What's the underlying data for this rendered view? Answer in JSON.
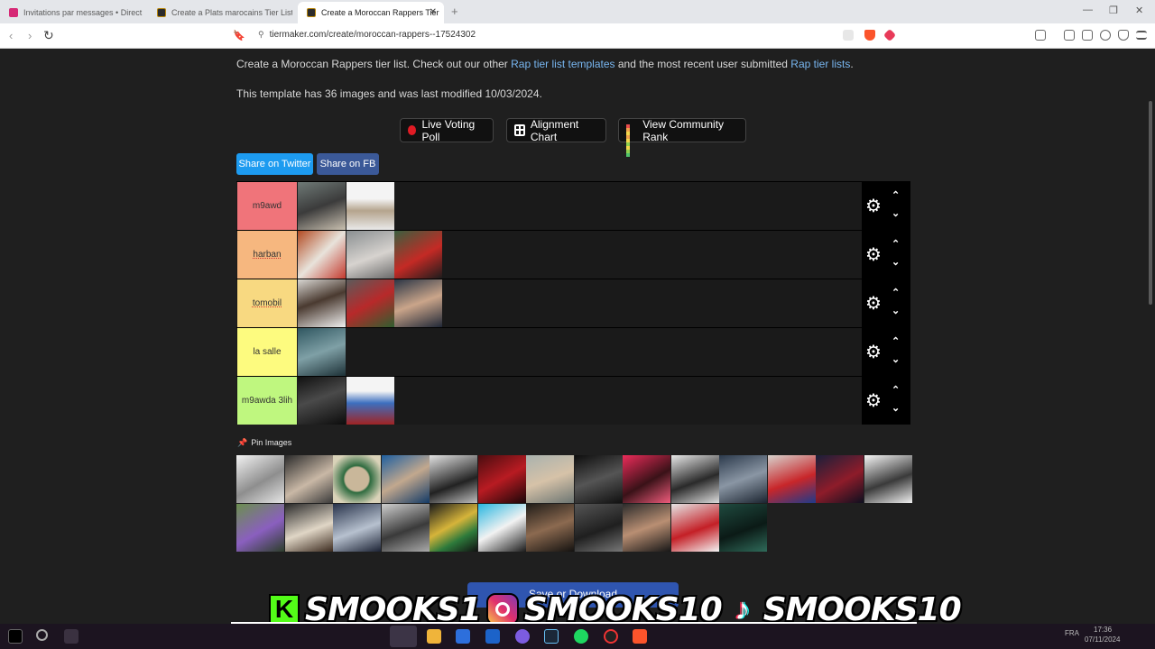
{
  "browser": {
    "tabs": [
      {
        "title": "Invitations par messages • Direct",
        "active": false,
        "favicon_color": "#d62976"
      },
      {
        "title": "Create a Plats marocains Tier List - Ti",
        "active": false,
        "favicon_color": "#2b2b2b"
      },
      {
        "title": "Create a Moroccan Rappers Tier",
        "active": true,
        "favicon_color": "#2b2b2b"
      }
    ],
    "close_glyph": "✕",
    "new_tab_glyph": "+",
    "window_controls": {
      "minimize": "—",
      "maximize": "❐",
      "close": "✕"
    },
    "nav": {
      "back": "‹",
      "forward": "›",
      "reload": "↻",
      "bookmark": "🔖"
    },
    "url": "tiermaker.com/create/moroccan-rappers--17524302",
    "lock_glyph": "⚲"
  },
  "page": {
    "intro": {
      "prefix": "Create a Moroccan Rappers tier list. Check out our other ",
      "link1": "Rap tier list templates",
      "middle": " and the most recent user submitted ",
      "link2": "Rap tier lists",
      "suffix": "."
    },
    "meta_text": "This template has 36 images and was last modified 10/03/2024.",
    "action_buttons": [
      {
        "label": "Live Voting Poll",
        "icon": "record-icon"
      },
      {
        "label": "Alignment Chart",
        "icon": "grid-icon"
      },
      {
        "label": "View Community Rank",
        "icon": "rank-icon"
      }
    ],
    "share_buttons": [
      {
        "label": "Share on Twitter",
        "color": "#1d9bf0"
      },
      {
        "label": "Share on FB",
        "color": "#3b5998"
      }
    ],
    "tiers": [
      {
        "label": "m9awd",
        "color": "#f0747a",
        "count": 2
      },
      {
        "label": "harban",
        "color": "#f6b77f",
        "count": 3
      },
      {
        "label": "tomobil",
        "color": "#f8d981",
        "count": 3
      },
      {
        "label": "la salle",
        "color": "#fdfb7f",
        "count": 1
      },
      {
        "label": "m9awda 3lih",
        "color": "#bff77f",
        "count": 2
      }
    ],
    "tier_controls": {
      "gear": "⚙",
      "up": "⌃",
      "down": "⌄"
    },
    "pin_label": "Pin Images",
    "pin_glyph": "📌",
    "pool_count": 26,
    "save_label": "Save or Download"
  },
  "watermark": {
    "kick_letter": "K",
    "handle1": "SMOOKS1",
    "handle2": "SMOOKS10",
    "handle3": "SMOOKS10",
    "tiktok_glyph": "♪"
  },
  "taskbar": {
    "lang": "FRA",
    "time": "17:36",
    "date": "07/11/2024"
  }
}
